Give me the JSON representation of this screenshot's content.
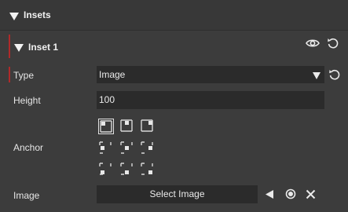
{
  "header": {
    "title": "Insets"
  },
  "inset": {
    "title": "Inset 1"
  },
  "fields": {
    "type_label": "Type",
    "type_value": "Image",
    "height_label": "Height",
    "height_value": "100",
    "anchor_label": "Anchor",
    "image_label": "Image",
    "select_image_label": "Select Image"
  },
  "anchors": {
    "positions": [
      "top-left",
      "top-center",
      "top-right",
      "middle-left",
      "center",
      "middle-right",
      "bottom-left",
      "bottom-center",
      "bottom-right"
    ],
    "selected": "top-left"
  },
  "icons": {
    "collapse": "triangle-down-icon",
    "visibility": "eye-icon",
    "reset": "reset-icon",
    "play": "play-left-icon",
    "record": "record-icon",
    "close": "close-icon"
  },
  "colors": {
    "accent_bar": "#b02a2a",
    "field_bg": "#2b2b2b",
    "panel_bg": "#3c3c3c"
  }
}
